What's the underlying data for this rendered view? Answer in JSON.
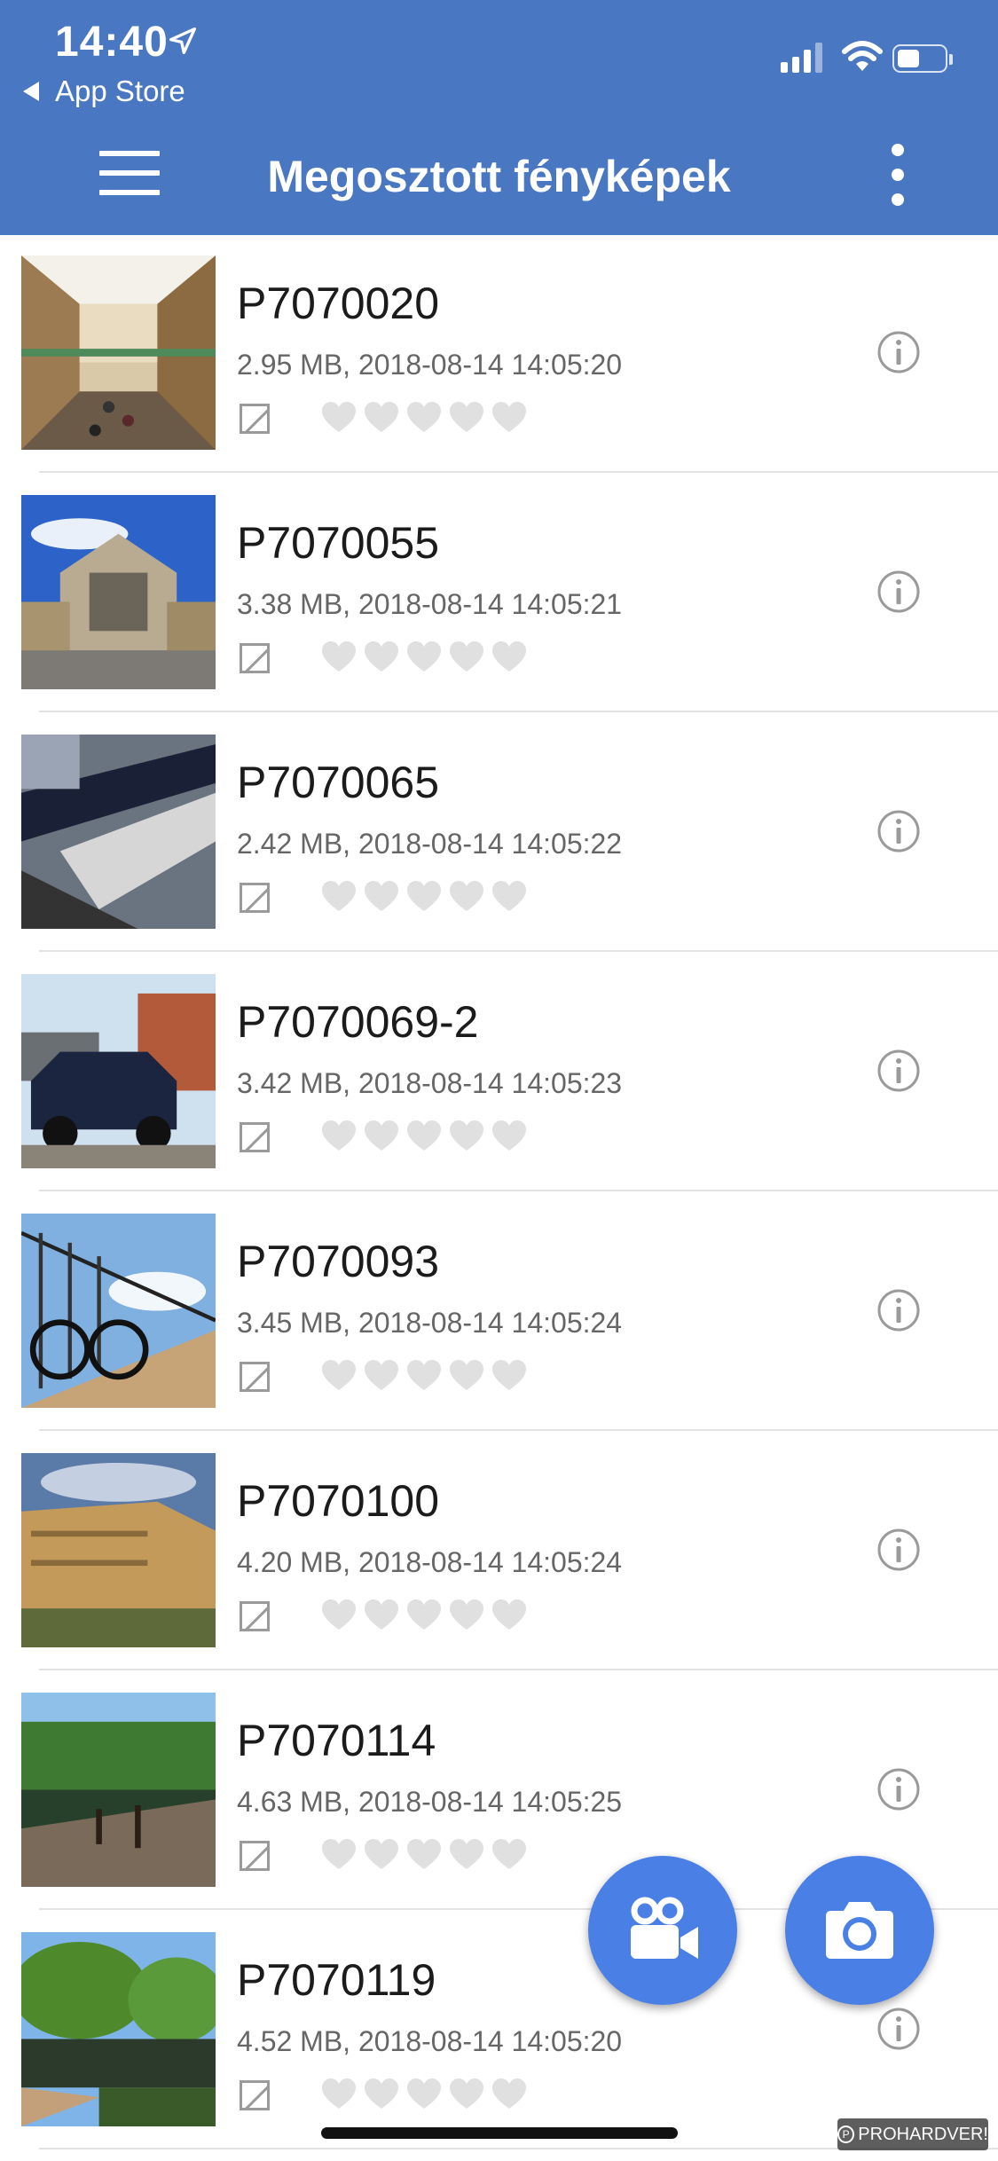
{
  "status_bar": {
    "time": "14:40",
    "back_label": "App Store"
  },
  "header": {
    "title": "Megosztott fényképek"
  },
  "photos": [
    {
      "name": "P7070020",
      "meta": "2.95 MB, 2018-08-14 14:05:20",
      "rating": 0,
      "thumb": "mall"
    },
    {
      "name": "P7070055",
      "meta": "3.38 MB, 2018-08-14 14:05:21",
      "rating": 0,
      "thumb": "station"
    },
    {
      "name": "P7070065",
      "meta": "2.42 MB, 2018-08-14 14:05:22",
      "rating": 0,
      "thumb": "escalator"
    },
    {
      "name": "P7070069-2",
      "meta": "3.42 MB, 2018-08-14 14:05:23",
      "rating": 0,
      "thumb": "car"
    },
    {
      "name": "P7070093",
      "meta": "3.45 MB, 2018-08-14 14:05:24",
      "rating": 0,
      "thumb": "bike"
    },
    {
      "name": "P7070100",
      "meta": "4.20 MB, 2018-08-14 14:05:24",
      "rating": 0,
      "thumb": "palace"
    },
    {
      "name": "P7070114",
      "meta": "4.63 MB, 2018-08-14 14:05:25",
      "rating": 0,
      "thumb": "lake"
    },
    {
      "name": "P7070119",
      "meta": "4.52 MB, 2018-08-14 14:05:20",
      "rating": 0,
      "thumb": "park"
    }
  ],
  "watermark": "PROHARDVER!",
  "colors": {
    "header": "#4a77c1",
    "fab": "#4a7fe6",
    "heart_inactive": "#e0e0e0"
  },
  "icons": {
    "menu": "hamburger-icon",
    "more": "kebab-icon",
    "info": "info-icon",
    "video": "video-camera-icon",
    "camera": "camera-icon"
  }
}
